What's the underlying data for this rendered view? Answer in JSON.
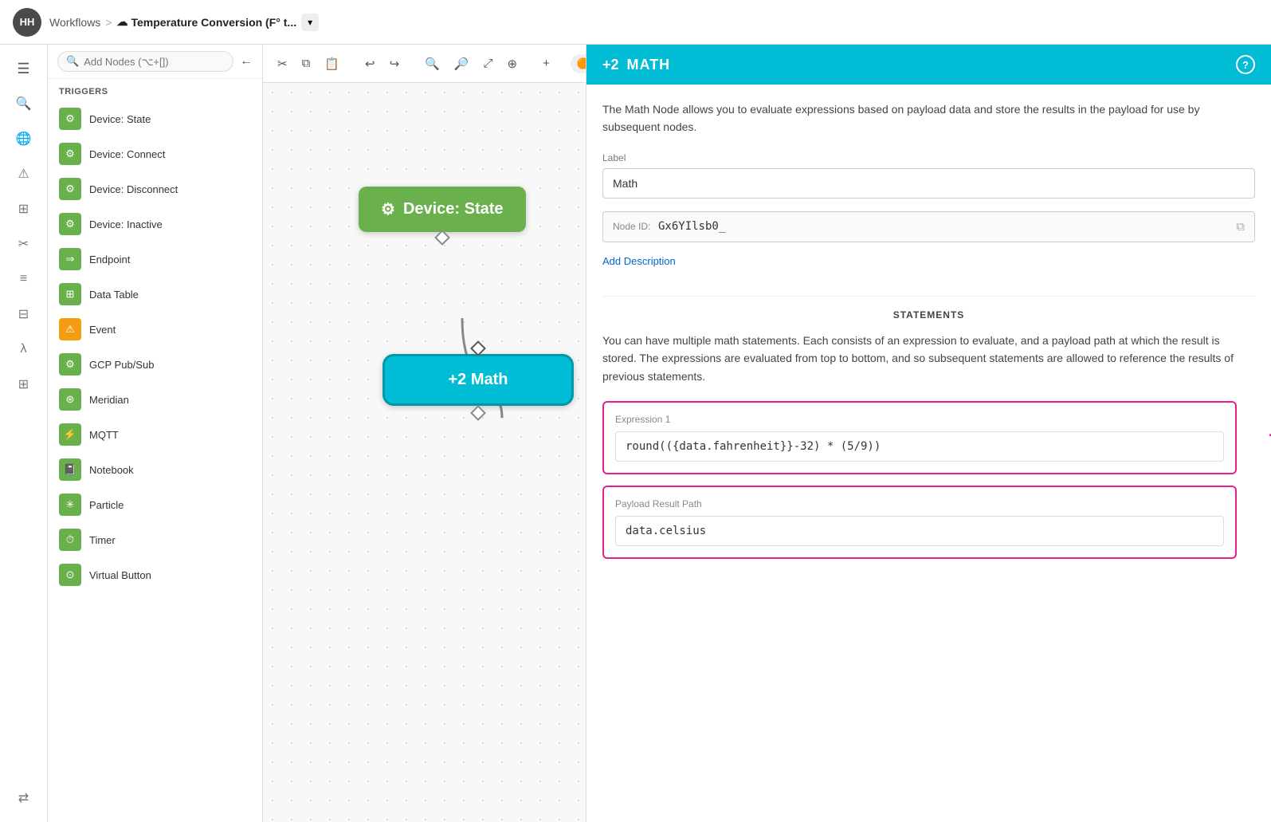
{
  "header": {
    "avatar": "HH",
    "breadcrumb_workflows": "Workflows",
    "breadcrumb_sep": ">",
    "workflow_name": "Temperature Conversion (F° t...",
    "dropdown_label": "▾"
  },
  "icon_sidebar": {
    "menu_icon": "☰",
    "search_icon": "🔍",
    "globe_icon": "🌐",
    "warning_icon": "⚠",
    "grid_icon": "⊞",
    "scissors_icon": "✂",
    "list_icon": "≡",
    "table_icon": "⊟",
    "lambda_icon": "λ",
    "grid2_icon": "⊞",
    "workflow_icon": "⇄"
  },
  "nodes_panel": {
    "search_placeholder": "Add Nodes (⌥+[])",
    "back_icon": "←",
    "triggers_label": "TRIGGERS",
    "nodes": [
      {
        "label": "Device: State",
        "icon": "⚙"
      },
      {
        "label": "Device: Connect",
        "icon": "⚙"
      },
      {
        "label": "Device: Disconnect",
        "icon": "⚙"
      },
      {
        "label": "Device: Inactive",
        "icon": "⚙"
      },
      {
        "label": "Endpoint",
        "icon": "⇒"
      },
      {
        "label": "Data Table",
        "icon": "⊞"
      },
      {
        "label": "Event",
        "icon": "⚠",
        "yellow": true
      },
      {
        "label": "GCP Pub/Sub",
        "icon": "⚙"
      },
      {
        "label": "Meridian",
        "icon": "⊛"
      },
      {
        "label": "MQTT",
        "icon": "⚡"
      },
      {
        "label": "Notebook",
        "icon": "📓"
      },
      {
        "label": "Particle",
        "icon": "✳"
      },
      {
        "label": "Timer",
        "icon": "⏱"
      },
      {
        "label": "Virtual Button",
        "icon": "⊙"
      }
    ]
  },
  "workflow_toolbar": {
    "cut_icon": "✂",
    "copy_icon": "⧉",
    "paste_icon": "📋",
    "undo_icon": "↩",
    "redo_icon": "↪",
    "zoom_out_icon": "🔍−",
    "zoom_in_icon": "🔍+",
    "fit_icon": "⤢",
    "zoom_select_icon": "🔍",
    "add_icon": "+",
    "toggle_state": "on"
  },
  "canvas": {
    "device_state_node_label": "Device: State",
    "device_state_icon": "⚙",
    "math_node_label": "+2  Math",
    "math_node_prefix": "+2"
  },
  "right_panel": {
    "header_badge": "+2",
    "header_title": "MATH",
    "description": "The Math Node allows you to evaluate expressions based on payload data and store the results in the payload for use by subsequent nodes.",
    "label_field_label": "Label",
    "label_value": "Math",
    "node_id_label": "Node ID:",
    "node_id_value": "Gx6YIlsb0_",
    "copy_icon": "⧉",
    "add_description_link": "Add Description",
    "statements_label": "STATEMENTS",
    "statements_desc": "You can have multiple math statements. Each consists of an expression to evaluate, and a payload path at which the result is stored. The expressions are evaluated from top to bottom, and so subsequent statements are allowed to reference the results of previous statements.",
    "expression1_label": "Expression 1",
    "expression1_value": "round(({data.fahrenheit}}-32) * (5/9))",
    "payload_label": "Payload Result Path",
    "payload_value": "data.celsius",
    "delete_icon": "−"
  }
}
